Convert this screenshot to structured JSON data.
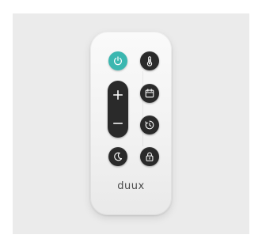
{
  "brand": {
    "logo_text": "duux"
  },
  "colors": {
    "backdrop": "#ebebeb",
    "remote_body": "#f4f4f4",
    "button": "#2a2a2a",
    "power_accent": "#3bb7b0",
    "icon": "#ffffff",
    "logo": "#4a4a4a"
  },
  "buttons": [
    {
      "id": "power",
      "icon": "power-icon"
    },
    {
      "id": "temperature",
      "icon": "thermometer-icon"
    },
    {
      "id": "increase",
      "icon": "plus-icon"
    },
    {
      "id": "decrease",
      "icon": "minus-icon"
    },
    {
      "id": "schedule",
      "icon": "calendar-icon"
    },
    {
      "id": "timer",
      "icon": "timer-icon"
    },
    {
      "id": "night-mode",
      "icon": "moon-icon"
    },
    {
      "id": "child-lock",
      "icon": "padlock-icon"
    }
  ]
}
